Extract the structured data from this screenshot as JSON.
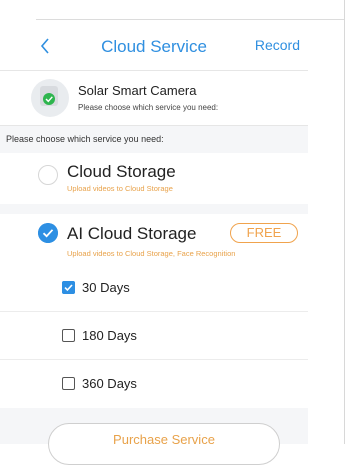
{
  "header": {
    "title": "Cloud Service",
    "record_label": "Record"
  },
  "device": {
    "name": "Solar Smart Camera",
    "subtitle": "Please choose which service you need:"
  },
  "choose_label": "Please choose which service you need:",
  "options": [
    {
      "title": "Cloud Storage",
      "subtitle": "Upload videos to Cloud Storage",
      "selected": false
    },
    {
      "title": "AI Cloud Storage",
      "subtitle": "Upload videos to Cloud Storage, Face Recognition",
      "badge": "FREE",
      "selected": true
    }
  ],
  "days": [
    {
      "label": "30 Days",
      "checked": true
    },
    {
      "label": "180 Days",
      "checked": false
    },
    {
      "label": "360 Days",
      "checked": false
    }
  ],
  "purchase_label": "Purchase Service",
  "colors": {
    "accent": "#2f8fe0",
    "orange": "#f0a34d",
    "green": "#2eb54e"
  }
}
